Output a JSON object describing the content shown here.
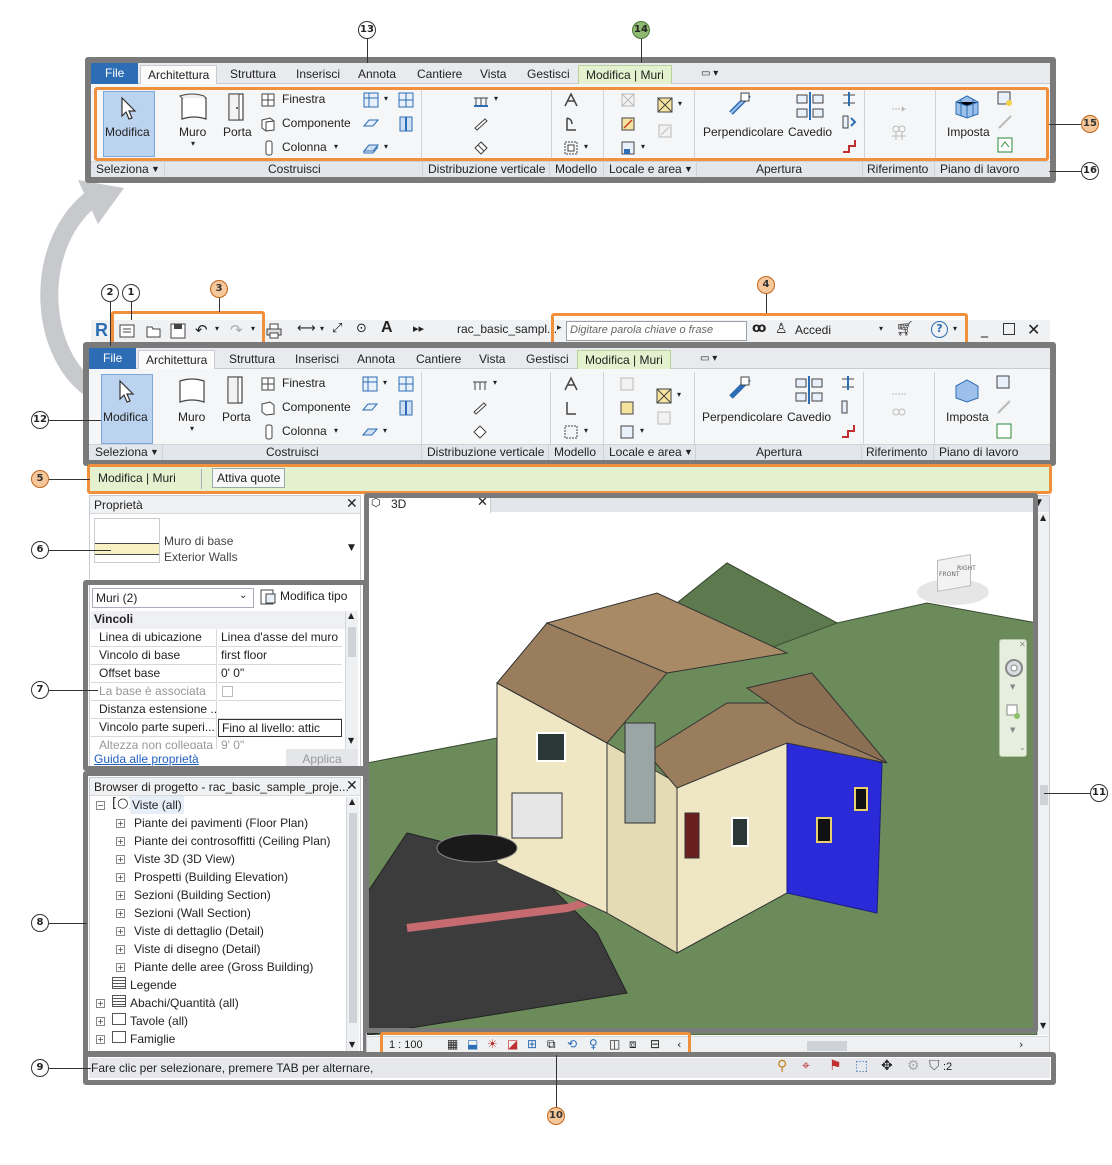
{
  "callouts": {
    "c1": "1",
    "c2": "2",
    "c3": "3",
    "c4": "4",
    "c5": "5",
    "c6": "6",
    "c7": "7",
    "c8": "8",
    "c9": "9",
    "c10": "10",
    "c11": "11",
    "c12": "12",
    "c13": "13",
    "c14": "14",
    "c15": "15",
    "c16": "16"
  },
  "ribbon": {
    "tabs": [
      "File",
      "Architettura",
      "Struttura",
      "Inserisci",
      "Annota",
      "Cantiere",
      "Vista",
      "Gestisci",
      "Modifica | Muri"
    ],
    "buttons": {
      "modifica": "Modifica",
      "muro": "Muro",
      "porta": "Porta",
      "finestra": "Finestra",
      "componente": "Componente",
      "colonna": "Colonna",
      "perpendicolare": "Perpendicolare",
      "cavedio": "Cavedio",
      "imposta": "Imposta"
    },
    "panels": [
      "Seleziona",
      "Costruisci",
      "Distribuzione verticale",
      "Modello",
      "Locale e area",
      "Apertura",
      "Riferimento",
      "Piano di lavoro"
    ]
  },
  "app": {
    "title": "rac_basic_sampl...",
    "search_placeholder": "Digitare parola chiave o frase",
    "signin": "Accedi",
    "help": "?"
  },
  "options_bar": {
    "context": "Modifica | Muri",
    "button": "Attiva quote"
  },
  "properties": {
    "title": "Proprietà",
    "type_line1": "Muro di base",
    "type_line2": "Exterior Walls",
    "selector": "Muri (2)",
    "edit_type": "Modifica tipo",
    "section": "Vincoli",
    "rows": [
      {
        "label": "Linea di ubicazione",
        "value": "Linea d'asse del muro"
      },
      {
        "label": "Vincolo di base",
        "value": "first floor"
      },
      {
        "label": "Offset base",
        "value": "0'  0\""
      },
      {
        "label": "La base è associata",
        "value": ""
      },
      {
        "label": "Distanza estensione ...",
        "value": ""
      },
      {
        "label": "Vincolo parte superi...",
        "value": "Fino al livello: attic"
      },
      {
        "label": "Altezza non collegata",
        "value": "9'  0\""
      }
    ],
    "help_link": "Guida alle proprietà",
    "apply": "Applica"
  },
  "browser": {
    "title": "Browser di progetto - rac_basic_sample_proje...",
    "items": [
      "Viste (all)",
      "Piante dei pavimenti (Floor Plan)",
      "Piante dei controsoffitti (Ceiling Plan)",
      "Viste 3D (3D View)",
      "Prospetti (Building Elevation)",
      "Sezioni (Building Section)",
      "Sezioni (Wall Section)",
      "Viste di dettaglio (Detail)",
      "Viste di disegno (Detail)",
      "Piante delle aree (Gross Building)",
      "Legende",
      "Abachi/Quantità (all)",
      "Tavole (all)",
      "Famiglie"
    ]
  },
  "view": {
    "tab": "3D",
    "scale": "1 : 100",
    "cube_left": "FRONT",
    "cube_right": "RIGHT"
  },
  "status": {
    "message": "Fare clic per selezionare, premere TAB per alternare,",
    "filter_count": ":2"
  },
  "colors": {
    "frame_gray": "#7a7a7a",
    "callout_orange": "#f0903c",
    "file_tab": "#2d6db5",
    "context_green": "#e3f1cf",
    "selected_wall": "#2a2ad8"
  }
}
